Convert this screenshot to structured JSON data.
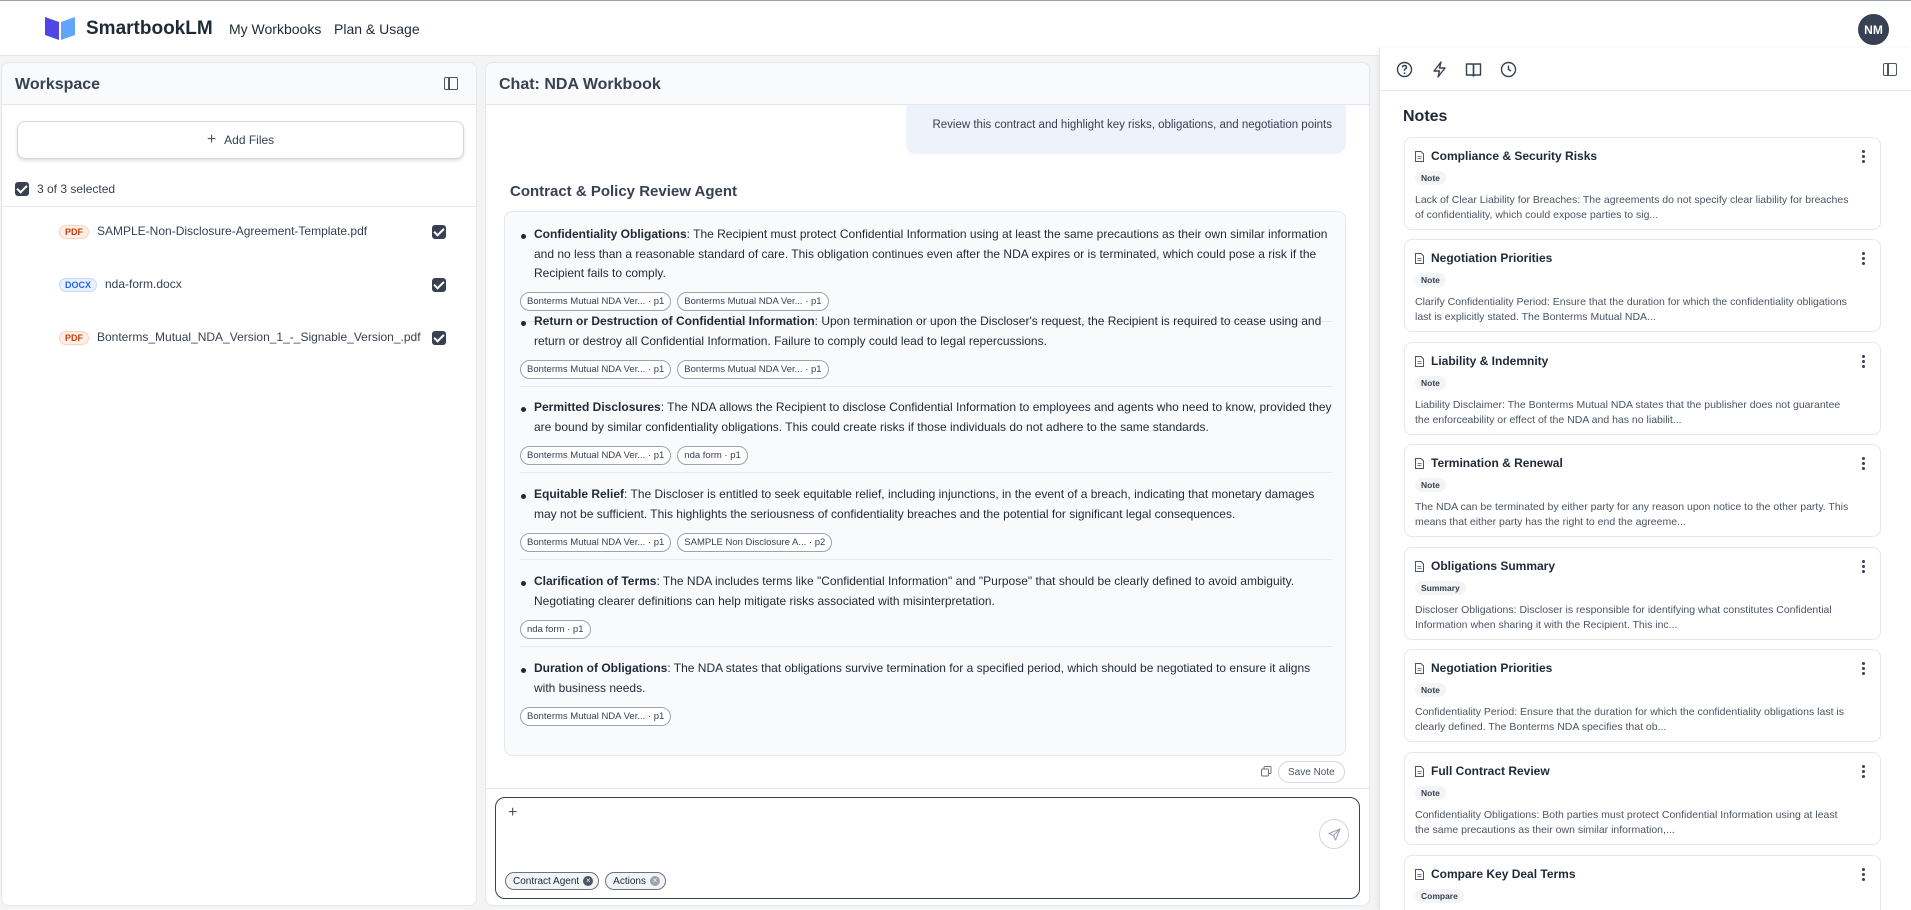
{
  "app": {
    "brand": "SmartbookLM",
    "nav": [
      "My Workbooks",
      "Plan & Usage"
    ],
    "avatar_initials": "NM",
    "accent_color": "#4f46e5"
  },
  "workspace": {
    "title": "Workspace",
    "add_files_label": "Add Files",
    "selected_text": "3 of 3 selected",
    "files": [
      {
        "type": "PDF",
        "name": "SAMPLE-Non-Disclosure-Agreement-Template.pdf",
        "checked": true
      },
      {
        "type": "DOCX",
        "name": "nda-form.docx",
        "checked": true
      },
      {
        "type": "PDF",
        "name": "Bonterms_Mutual_NDA_Version_1_-_Signable_Version_.pdf",
        "checked": true
      }
    ]
  },
  "chat": {
    "title": "Chat: NDA Workbook",
    "user_message": "Review this contract and highlight key risks, obligations, and negotiation points",
    "agent_name": "Contract & Policy Review Agent",
    "items": [
      {
        "heading": "Confidentiality Obligations",
        "text": ": The Recipient must protect Confidential Information using at least the same precautions as their own similar information and no less than a reasonable standard of care. This obligation continues even after the NDA expires or is terminated, which could pose a risk if the Recipient fails to comply.",
        "citations": [
          "Bonterms Mutual NDA Ver... · p1",
          "Bonterms Mutual NDA Ver... · p1"
        ]
      },
      {
        "heading": "Return or Destruction of Confidential Information",
        "text": ": Upon termination or upon the Discloser's request, the Recipient is required to cease using and return or destroy all Confidential Information. Failure to comply could lead to legal repercussions.",
        "citations": [
          "Bonterms Mutual NDA Ver... · p1",
          "Bonterms Mutual NDA Ver... · p1"
        ]
      },
      {
        "heading": "Permitted Disclosures",
        "text": ": The NDA allows the Recipient to disclose Confidential Information to employees and agents who need to know, provided they are bound by similar confidentiality obligations. This could create risks if those individuals do not adhere to the same standards.",
        "citations": [
          "Bonterms Mutual NDA Ver... · p1",
          "nda form · p1"
        ]
      },
      {
        "heading": "Equitable Relief",
        "text": ": The Discloser is entitled to seek equitable relief, including injunctions, in the event of a breach, indicating that monetary damages may not be sufficient. This highlights the seriousness of confidentiality breaches and the potential for significant legal consequences.",
        "citations": [
          "Bonterms Mutual NDA Ver... · p1",
          "SAMPLE Non Disclosure A... · p2"
        ]
      },
      {
        "heading": "Clarification of Terms",
        "text": ": The NDA includes terms like \"Confidential Information\" and \"Purpose\" that should be clearly defined to avoid ambiguity. Negotiating clearer definitions can help mitigate risks associated with misinterpretation.",
        "citations": [
          "nda form · p1"
        ]
      },
      {
        "heading": "Duration of Obligations",
        "text": ": The NDA states that obligations survive termination for a specified period, which should be negotiated to ensure it aligns with business needs.",
        "citations": [
          "Bonterms Mutual NDA Ver... · p1"
        ]
      }
    ],
    "save_note_label": "Save Note",
    "input_placeholder": "",
    "tags": [
      "Contract Agent",
      "Actions"
    ]
  },
  "notes": {
    "title": "Notes",
    "cards": [
      {
        "title": "Compliance & Security Risks",
        "badge": "Note",
        "preview": "Lack of Clear Liability for Breaches: The agreements do not specify clear liability for breaches of confidentiality, which could expose parties to sig..."
      },
      {
        "title": "Negotiation Priorities",
        "badge": "Note",
        "preview": "Clarify Confidentiality Period: Ensure that the duration for which the confidentiality obligations last is explicitly stated. The Bonterms Mutual NDA..."
      },
      {
        "title": "Liability & Indemnity",
        "badge": "Note",
        "preview": "Liability Disclaimer: The Bonterms Mutual NDA states that the publisher does not guarantee the enforceability or effect of the NDA and has no liabilit..."
      },
      {
        "title": "Termination & Renewal",
        "badge": "Note",
        "preview": "The NDA can be terminated by either party for any reason upon notice to the other party. This means that either party has the right to end the agreeme..."
      },
      {
        "title": "Obligations Summary",
        "badge": "Summary",
        "preview": "Discloser Obligations: Discloser is responsible for identifying what constitutes Confidential Information when sharing it with the Recipient. This inc..."
      },
      {
        "title": "Negotiation Priorities",
        "badge": "Note",
        "preview": "Confidentiality Period: Ensure that the duration for which the confidentiality obligations last is clearly defined. The Bonterms NDA specifies that ob..."
      },
      {
        "title": "Full Contract Review",
        "badge": "Note",
        "preview": "Confidentiality Obligations: Both parties must protect Confidential Information using at least the same precautions as their own similar information,..."
      },
      {
        "title": "Compare Key Deal Terms",
        "badge": "Compare",
        "preview": ""
      }
    ]
  }
}
